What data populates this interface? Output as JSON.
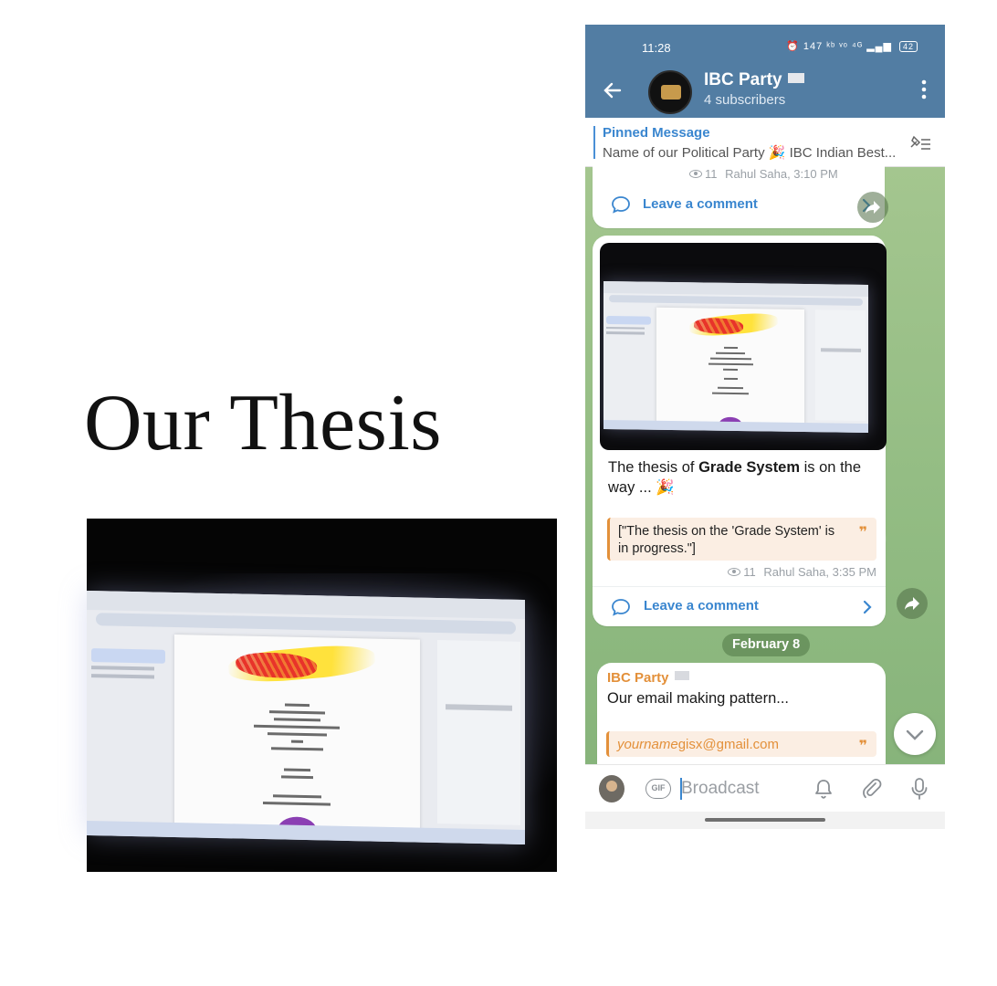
{
  "slide": {
    "title": "Our Thesis"
  },
  "phone": {
    "status": {
      "time": "11:28",
      "icons": "⏰ 147 ᵏᵇ ᵛᵒ ⁴ᴳ ▂▄▆",
      "battery": "42"
    },
    "header": {
      "channel_name": "IBC Party",
      "subscribers": "4 subscribers"
    },
    "pinned": {
      "title": "Pinned Message",
      "text": "Name of our Political Party 🎉 IBC Indian  Best..."
    },
    "post1": {
      "views": "11",
      "meta": "Rahul Saha, 3:10 PM",
      "comment_label": "Leave a comment"
    },
    "post2": {
      "text_before": "The thesis of ",
      "text_bold": "Grade System",
      "text_after": " is on the way ... 🎉",
      "quote": "[\"The thesis on the 'Grade System' is in progress.\"]",
      "quote_mark": "❞",
      "views": "11",
      "meta": "Rahul Saha, 3:35 PM",
      "comment_label": "Leave a comment"
    },
    "date_divider": "February 8",
    "post3": {
      "author": "IBC Party",
      "text": "Our email making pattern...",
      "quote_italic": "yourname",
      "quote_rest": "gisx@gmail.com",
      "quote_mark": "❞"
    },
    "input": {
      "gif_label": "GIF",
      "placeholder": "Broadcast"
    },
    "colors": {
      "header": "#527da3",
      "accent": "#3a86cf",
      "quote_accent": "#e3903a",
      "chat_background": "#9fc48e"
    }
  }
}
